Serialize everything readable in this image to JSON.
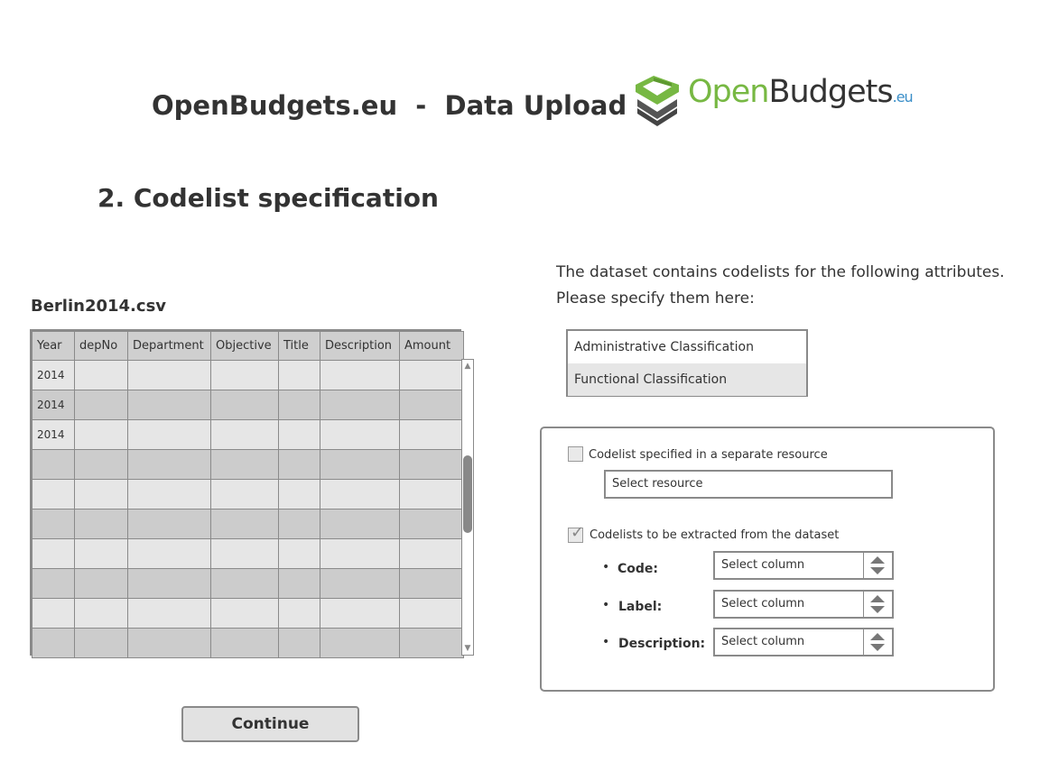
{
  "header": {
    "title": "OpenBudgets.eu  -  Data Upload",
    "logo": {
      "open": "Open",
      "budgets": "Budgets",
      "eu": ".eu"
    }
  },
  "section_title": "2. Codelist specification",
  "file": {
    "name": "Berlin2014.csv",
    "columns": [
      "Year",
      "depNo",
      "Department",
      "Objective",
      "Title",
      "Description",
      "Amount"
    ],
    "rows": [
      [
        "2014",
        "",
        "",
        "",
        "",
        "",
        ""
      ],
      [
        "2014",
        "",
        "",
        "",
        "",
        "",
        ""
      ],
      [
        "2014",
        "",
        "",
        "",
        "",
        "",
        ""
      ],
      [
        "",
        "",
        "",
        "",
        "",
        "",
        ""
      ],
      [
        "",
        "",
        "",
        "",
        "",
        "",
        ""
      ],
      [
        "",
        "",
        "",
        "",
        "",
        "",
        ""
      ],
      [
        "",
        "",
        "",
        "",
        "",
        "",
        ""
      ],
      [
        "",
        "",
        "",
        "",
        "",
        "",
        ""
      ],
      [
        "",
        "",
        "",
        "",
        "",
        "",
        ""
      ],
      [
        "",
        "",
        "",
        "",
        "",
        "",
        ""
      ]
    ]
  },
  "intro": {
    "line1": "The dataset contains codelists for the following attributes.",
    "line2": "Please specify them here:"
  },
  "attributes": {
    "items": [
      "Administrative Classification",
      "Functional Classification"
    ],
    "selected": "Functional Classification"
  },
  "codelist_panel": {
    "separate_resource": {
      "label": "Codelist specified in a separate resource",
      "checked": false,
      "field_value": "Select resource"
    },
    "extract": {
      "label": "Codelists to be extracted from the dataset",
      "checked": true,
      "fields": [
        {
          "label": "Code:",
          "value": "Select column"
        },
        {
          "label": "Label:",
          "value": "Select column"
        },
        {
          "label": "Description:",
          "value": "Select column"
        }
      ]
    }
  },
  "continue_label": "Continue",
  "colors": {
    "logo_green": "#77b843",
    "logo_blue": "#3a8ec8",
    "border": "#8a8a8a"
  },
  "icons": {
    "logo": "openbudgets-logo-icon",
    "checkbox_checked": "checkmark-icon",
    "spinner": "up-down-arrows-icon"
  }
}
